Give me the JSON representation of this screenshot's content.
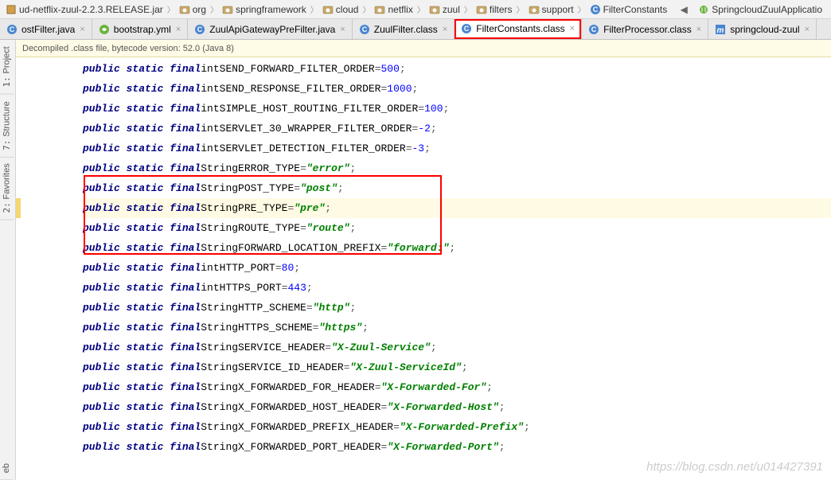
{
  "breadcrumb": {
    "items": [
      {
        "label": "ud-netflix-zuul-2.2.3.RELEASE.jar",
        "icon": "jar"
      },
      {
        "label": "org",
        "icon": "pkg"
      },
      {
        "label": "springframework",
        "icon": "pkg"
      },
      {
        "label": "cloud",
        "icon": "pkg"
      },
      {
        "label": "netflix",
        "icon": "pkg"
      },
      {
        "label": "zuul",
        "icon": "pkg"
      },
      {
        "label": "filters",
        "icon": "pkg"
      },
      {
        "label": "support",
        "icon": "pkg"
      },
      {
        "label": "FilterConstants",
        "icon": "class"
      }
    ],
    "right_app": "SpringcloudZuulApplicatio"
  },
  "tabs": [
    {
      "label": "ostFilter.java",
      "icon": "class",
      "close": true
    },
    {
      "label": "bootstrap.yml",
      "icon": "spring",
      "close": true
    },
    {
      "label": "ZuulApiGatewayPreFilter.java",
      "icon": "class",
      "close": true
    },
    {
      "label": "ZuulFilter.class",
      "icon": "class",
      "close": true
    },
    {
      "label": "FilterConstants.class",
      "icon": "class",
      "close": true,
      "active": true,
      "highlight": true
    },
    {
      "label": "FilterProcessor.class",
      "icon": "class",
      "close": true
    },
    {
      "label": "springcloud-zuul",
      "icon": "m",
      "close": true
    }
  ],
  "sidebar": {
    "tools": [
      {
        "num": "1:",
        "label": "Project"
      },
      {
        "num": "7:",
        "label": "Structure"
      },
      {
        "num": "2:",
        "label": "Favorites"
      }
    ],
    "bottom": "eb"
  },
  "info_bar": "Decompiled .class file, bytecode version: 52.0 (Java 8)",
  "code": [
    {
      "kw": "public static final",
      "type": "int",
      "name": "SEND_FORWARD_FILTER_ORDER",
      "eq": "=",
      "val": "500",
      "vtype": "num"
    },
    {
      "kw": "public static final",
      "type": "int",
      "name": "SEND_RESPONSE_FILTER_ORDER",
      "eq": "=",
      "val": "1000",
      "vtype": "num"
    },
    {
      "kw": "public static final",
      "type": "int",
      "name": "SIMPLE_HOST_ROUTING_FILTER_ORDER",
      "eq": "=",
      "val": "100",
      "vtype": "num"
    },
    {
      "kw": "public static final",
      "type": "int",
      "name": "SERVLET_30_WRAPPER_FILTER_ORDER",
      "eq": "=",
      "val": "-2",
      "vtype": "num"
    },
    {
      "kw": "public static final",
      "type": "int",
      "name": "SERVLET_DETECTION_FILTER_ORDER",
      "eq": "=",
      "val": "-3",
      "vtype": "num"
    },
    {
      "kw": "public static final",
      "type": "String",
      "name": "ERROR_TYPE",
      "eq": "=",
      "val": "\"error\"",
      "vtype": "str"
    },
    {
      "kw": "public static final",
      "type": "String",
      "name": "POST_TYPE",
      "eq": "=",
      "val": "\"post\"",
      "vtype": "str"
    },
    {
      "kw": "public static final",
      "type": "String",
      "name": "PRE_TYPE",
      "eq": "=",
      "val": "\"pre\"",
      "vtype": "str",
      "hl": true
    },
    {
      "kw": "public static final",
      "type": "String",
      "name": "ROUTE_TYPE",
      "eq": "=",
      "val": "\"route\"",
      "vtype": "str"
    },
    {
      "kw": "public static final",
      "type": "String",
      "name": "FORWARD_LOCATION_PREFIX",
      "eq": "=",
      "val": "\"forward:\"",
      "vtype": "str"
    },
    {
      "kw": "public static final",
      "type": "int",
      "name": "HTTP_PORT",
      "eq": "=",
      "val": "80",
      "vtype": "num"
    },
    {
      "kw": "public static final",
      "type": "int",
      "name": "HTTPS_PORT",
      "eq": "=",
      "val": "443",
      "vtype": "num"
    },
    {
      "kw": "public static final",
      "type": "String",
      "name": "HTTP_SCHEME",
      "eq": "=",
      "val": "\"http\"",
      "vtype": "str"
    },
    {
      "kw": "public static final",
      "type": "String",
      "name": "HTTPS_SCHEME",
      "eq": "=",
      "val": "\"https\"",
      "vtype": "str"
    },
    {
      "kw": "public static final",
      "type": "String",
      "name": "SERVICE_HEADER",
      "eq": "=",
      "val": "\"X-Zuul-Service\"",
      "vtype": "str"
    },
    {
      "kw": "public static final",
      "type": "String",
      "name": "SERVICE_ID_HEADER",
      "eq": "=",
      "val": "\"X-Zuul-ServiceId\"",
      "vtype": "str"
    },
    {
      "kw": "public static final",
      "type": "String",
      "name": "X_FORWARDED_FOR_HEADER",
      "eq": "=",
      "val": "\"X-Forwarded-For\"",
      "vtype": "str"
    },
    {
      "kw": "public static final",
      "type": "String",
      "name": "X_FORWARDED_HOST_HEADER",
      "eq": "=",
      "val": "\"X-Forwarded-Host\"",
      "vtype": "str"
    },
    {
      "kw": "public static final",
      "type": "String",
      "name": "X_FORWARDED_PREFIX_HEADER",
      "eq": "=",
      "val": "\"X-Forwarded-Prefix\"",
      "vtype": "str"
    },
    {
      "kw": "public static final",
      "type": "String",
      "name": "X_FORWARDED_PORT_HEADER",
      "eq": "=",
      "val": "\"X-Forwarded-Port\"",
      "vtype": "str"
    }
  ],
  "watermark": "https://blog.csdn.net/u014427391"
}
